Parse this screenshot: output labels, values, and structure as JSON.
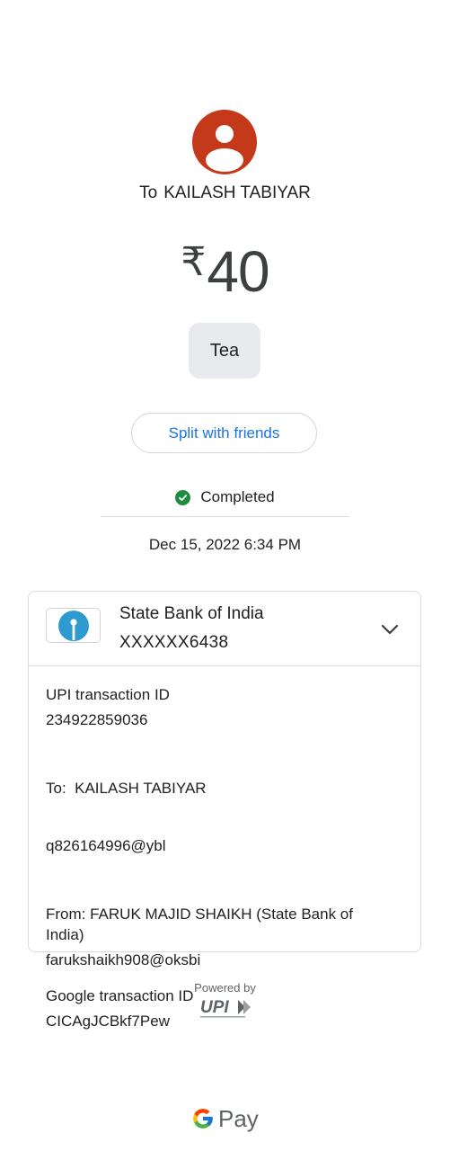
{
  "payee": {
    "prefix": "To",
    "name": "KAILASH TABIYAR"
  },
  "amount": {
    "currency_symbol": "₹",
    "value": "40"
  },
  "note": "Tea",
  "split_button_label": "Split with friends",
  "status": {
    "text": "Completed",
    "color": "#1e8e3e",
    "icon": "check-circle-icon"
  },
  "datetime": "Dec 15, 2022 6:34 PM",
  "bank": {
    "name": "State Bank of India",
    "account": "XXXXXX6438",
    "logo_icon": "sbi-logo-icon",
    "expand_icon": "chevron-down-icon"
  },
  "details": {
    "upi_txn": {
      "label": "UPI transaction ID",
      "value": "234922859036"
    },
    "to": {
      "label": "To:  KAILASH TABIYAR",
      "value": "q826164996@ybl"
    },
    "from": {
      "label": "From: FARUK MAJID SHAIKH (State Bank of India)",
      "value": "farukshaikh908@oksbi"
    },
    "google_txn": {
      "label": "Google transaction ID",
      "value": "CICAgJCBkf7Pew"
    }
  },
  "footer": {
    "powered_by": "Powered by",
    "upi_logo_text": "UPI",
    "brand": "Pay"
  },
  "colors": {
    "avatar_bg": "#c5391b",
    "link_blue": "#1a73e8",
    "sbi_blue": "#2d9bd0"
  }
}
